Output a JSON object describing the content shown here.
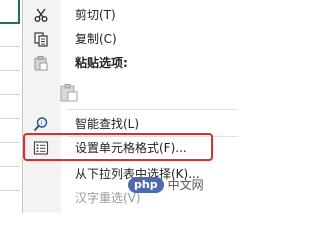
{
  "menu": {
    "cut": "剪切(T)",
    "copy": "复制(C)",
    "paste_options": "粘贴选项:",
    "smart_lookup": "智能查找(L)",
    "format_cells": "设置单元格格式(F)...",
    "pick_from_list": "从下拉列表中选择(K)...",
    "chinese_reconvert": "汉字重选(V)"
  },
  "watermark": {
    "badge": "php",
    "text": "中文网"
  },
  "colors": {
    "highlight_border": "#d93127",
    "grid_accent": "#217346"
  }
}
